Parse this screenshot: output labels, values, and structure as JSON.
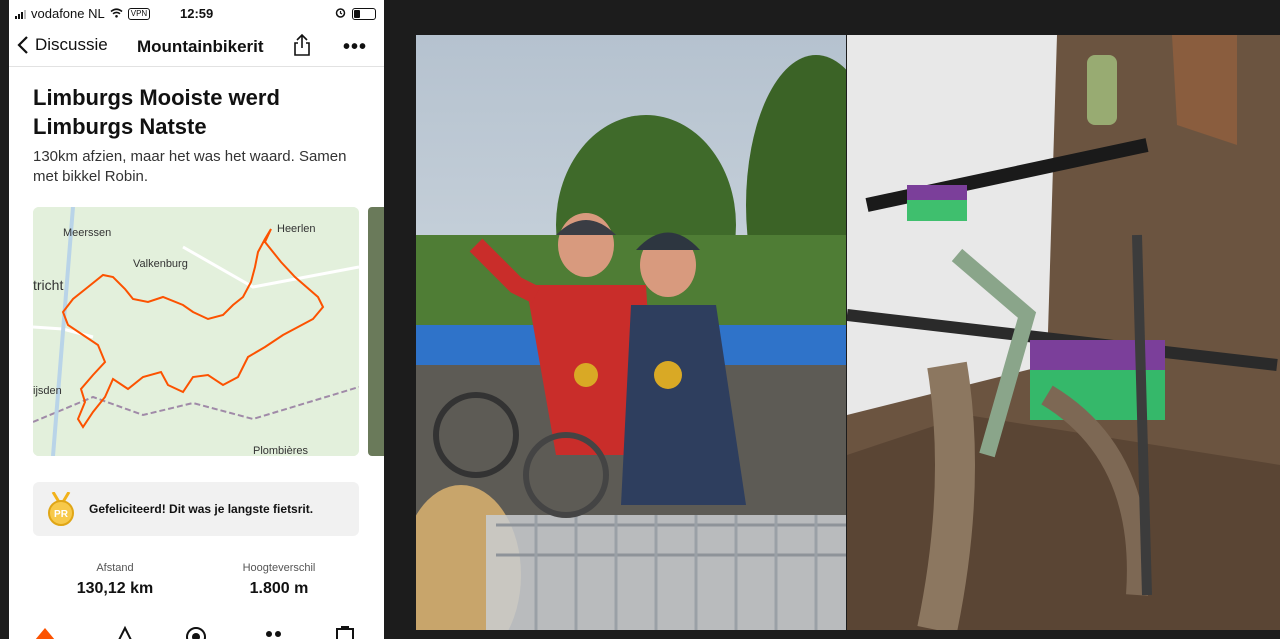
{
  "status": {
    "carrier": "vodafone NL",
    "vpn": "VPN",
    "time": "12:59"
  },
  "nav": {
    "back_label": "Discussie",
    "title": "Mountainbikerit"
  },
  "post": {
    "title": "Limburgs Mooiste werd Limburgs Natste",
    "description": "130km afzien, maar het was het waard. Samen met bikkel Robin."
  },
  "map": {
    "places": [
      "Meerssen",
      "Heerlen",
      "Valkenburg",
      "tricht",
      "ijsden",
      "Plombières"
    ],
    "route_color": "#fc5200"
  },
  "achievement": {
    "badge": "PR",
    "text": "Gefeliciteerd! Dit was je langste fietsrit."
  },
  "stats": [
    {
      "label": "Afstand",
      "value": "130,12 km"
    },
    {
      "label": "Hoogteverschil",
      "value": "1.800 m"
    }
  ],
  "tabs": [
    "home-icon",
    "routes-icon",
    "record-icon",
    "groups-icon",
    "clipboard-icon"
  ],
  "colors": {
    "accent": "#fc5200"
  }
}
